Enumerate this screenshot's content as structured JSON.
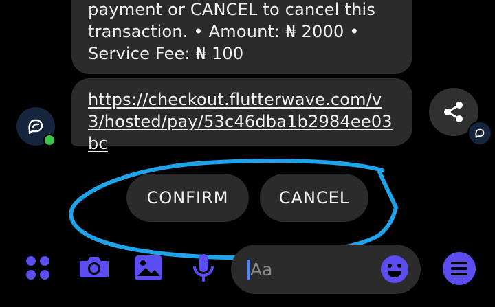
{
  "messages": {
    "partial_text": "payment or CANCEL to cancel this transaction. • Amount: ₦ 2000 • Service Fee: ₦ 100",
    "link": "https://checkout.flutterwave.com/v3/hosted/pay/53c46dba1b2984ee03bc"
  },
  "quick_replies": {
    "confirm": "CONFIRM",
    "cancel": "CANCEL"
  },
  "composer": {
    "placeholder": "Aa"
  },
  "icons": {
    "avatar": "bot-chat-icon",
    "share": "share-icon",
    "apps": "apps-grid-icon",
    "camera": "camera-icon",
    "gallery": "image-icon",
    "mic": "microphone-icon",
    "emoji": "smiley-icon",
    "menu": "menu-icon"
  },
  "colors": {
    "accent": "#5b4df0",
    "annotation": "#1fa3ea",
    "bubble": "#2b2b2b",
    "online": "#3fc34d"
  }
}
